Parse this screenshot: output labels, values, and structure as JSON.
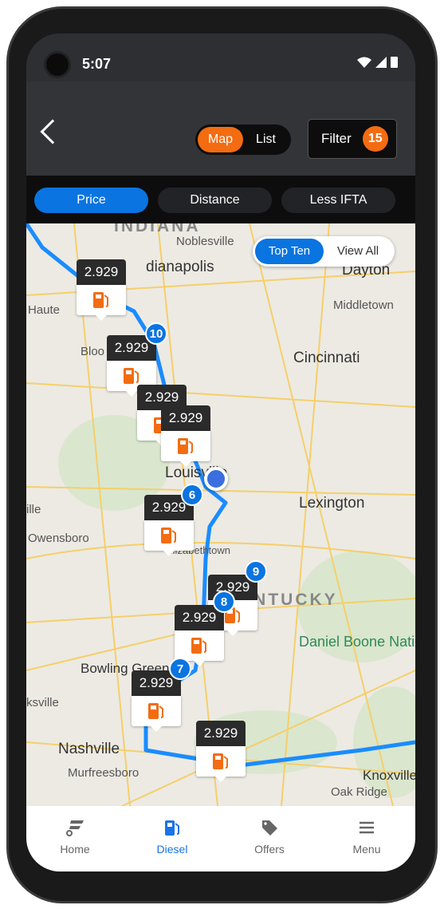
{
  "status_bar": {
    "time": "5:07"
  },
  "header": {
    "view_toggle": {
      "map": "Map",
      "list": "List",
      "selected": "Map"
    },
    "filter": {
      "label": "Filter",
      "count": "15"
    }
  },
  "sort_chips": [
    {
      "label": "Price",
      "selected": true
    },
    {
      "label": "Distance",
      "selected": false
    },
    {
      "label": "Less IFTA",
      "selected": false
    }
  ],
  "map": {
    "toggle": {
      "top_ten": "Top Ten",
      "view_all": "View All",
      "selected": "Top Ten"
    },
    "labels": {
      "indiana": "INDIANA",
      "noblesville": "Noblesville",
      "indianapolis": "dianapolis",
      "haute": "Haute",
      "bloo": "Bloo",
      "dayton": "Dayton",
      "middletown": "Middletown",
      "cincinnati": "Cincinnati",
      "louisville": "Louisville",
      "lexington": "Lexington",
      "owensboro": "Owensboro",
      "elizabethtown": "Elizabethtown",
      "kentucky": "KENTUCKY",
      "bowling_green": "Bowling Green",
      "park": "Daniel Boone National Forest",
      "nashville": "Nashville",
      "murfreesboro": "Murfreesboro",
      "knoxville": "Knoxville",
      "oak_ridge": "Oak Ridge",
      "clarksville": "ksville",
      "ille": "ille"
    },
    "markers": [
      {
        "price": "2.929"
      },
      {
        "price": "2.929",
        "rank": "10"
      },
      {
        "price": "2.929"
      },
      {
        "price": "2.929"
      },
      {
        "price": "2.929",
        "rank": "6"
      },
      {
        "price": "2.929",
        "rank": "9"
      },
      {
        "price": "2.929",
        "rank": "8"
      },
      {
        "price": "2.929",
        "rank": "7"
      },
      {
        "price": "2.929"
      }
    ],
    "route_color": "#1a8cff"
  },
  "bottom_nav": [
    {
      "label": "Home"
    },
    {
      "label": "Diesel",
      "active": true
    },
    {
      "label": "Offers"
    },
    {
      "label": "Menu"
    }
  ],
  "colors": {
    "accent_orange": "#f36c12",
    "accent_blue": "#0a74e0"
  }
}
